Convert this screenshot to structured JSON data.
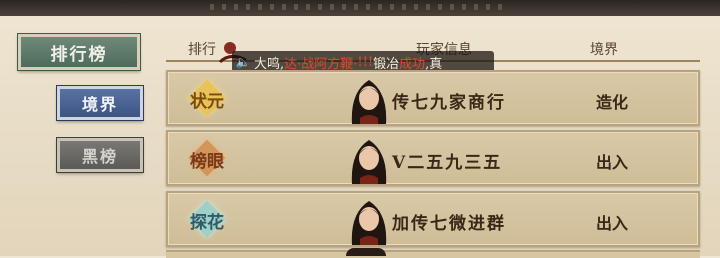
{
  "nav": {
    "rank_label": "排行榜",
    "realm_label": "境界",
    "black_label": "黑榜"
  },
  "table": {
    "header": {
      "rank": "排行",
      "player": "玩家信息",
      "realm": "境界"
    },
    "rows": [
      {
        "badge": "状元",
        "name": "传七九家商行",
        "realm": "造化"
      },
      {
        "badge": "榜眼",
        "name": "V二五九三五",
        "realm": "出入"
      },
      {
        "badge": "探花",
        "name": "加传七微进群",
        "realm": "出入"
      }
    ]
  },
  "marquee": {
    "speaker_icon": "speaker-icon",
    "text_a": "大鸣,",
    "text_red1": "达·战阿方鞭·",
    "text_red2": "!!!",
    "text_b": " 锻冶",
    "text_red3": "成功",
    "text_c": ",真"
  },
  "colors": {
    "nav_rank": "#5a7767",
    "nav_realm": "#4a6190",
    "nav_black": "#6a6864",
    "row_bg": "#d4c39e"
  }
}
